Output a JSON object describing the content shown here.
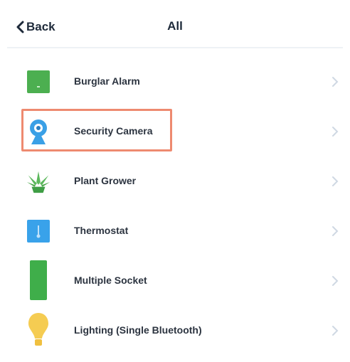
{
  "nav": {
    "back_label": "Back",
    "title": "All"
  },
  "colors": {
    "highlight": "#ee8a70",
    "chevron": "#cfd8e3",
    "burglar_alarm_icon": "#4caf50",
    "security_camera_icon": "#3aa0e6",
    "plant_grower_icon": "#5cb85c",
    "thermostat_icon": "#39a2ea",
    "multiple_socket_icon": "#3fae4a",
    "lighting_icon": "#f5cc52"
  },
  "devices": [
    {
      "label": "Burglar Alarm",
      "icon": "burglar-alarm-icon"
    },
    {
      "label": "Security Camera",
      "icon": "security-camera-icon",
      "highlighted": true
    },
    {
      "label": "Plant Grower",
      "icon": "plant-grower-icon"
    },
    {
      "label": "Thermostat",
      "icon": "thermostat-icon"
    },
    {
      "label": "Multiple Socket",
      "icon": "multiple-socket-icon"
    },
    {
      "label": "Lighting (Single Bluetooth)",
      "icon": "lighting-icon"
    }
  ]
}
